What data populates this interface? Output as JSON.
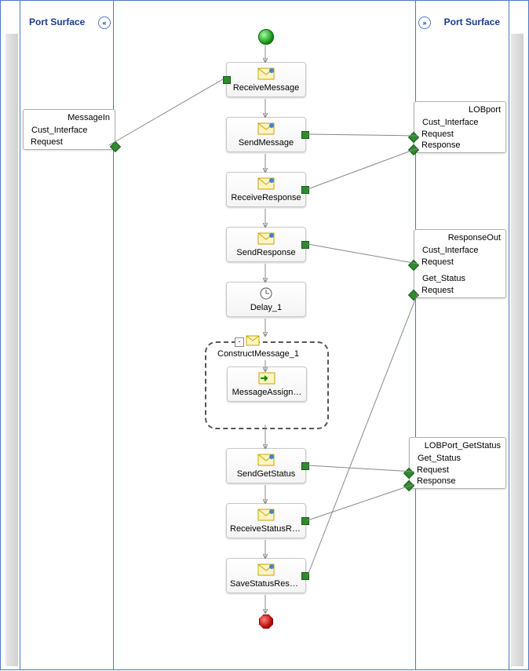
{
  "leftSurfaceLabel": "Port Surface",
  "rightSurfaceLabel": "Port Surface",
  "leftCollapseGlyph": "«",
  "rightCollapseGlyph": "»",
  "ports": {
    "messageIn": {
      "title": "MessageIn",
      "operation": "Cust_Interface",
      "rows": [
        "Request"
      ]
    },
    "lobPort": {
      "title": "LOBport",
      "operation": "Cust_Interface",
      "rows": [
        "Request",
        "Response"
      ]
    },
    "responseOut": {
      "title": "ResponseOut",
      "op1": "Cust_Interface",
      "rows1": [
        "Request"
      ],
      "op2": "Get_Status",
      "rows2": [
        "Request"
      ]
    },
    "lobGetStatus": {
      "title": "LOBPort_GetStatus",
      "operation": "Get_Status",
      "rows": [
        "Request",
        "Response"
      ]
    }
  },
  "shapes": {
    "receiveMessage": "ReceiveMessage",
    "sendMessage": "SendMessage",
    "receiveResponse": "ReceiveResponse",
    "sendResponse": "SendResponse",
    "delay": "Delay_1",
    "construct": "ConstructMessage_1",
    "messageAssign": "MessageAssign…",
    "sendGetStatus": "SendGetStatus",
    "receiveStatusRe": "ReceiveStatusRe…",
    "saveStatusResp": "SaveStatusResp…"
  },
  "collapseMinus": "-"
}
